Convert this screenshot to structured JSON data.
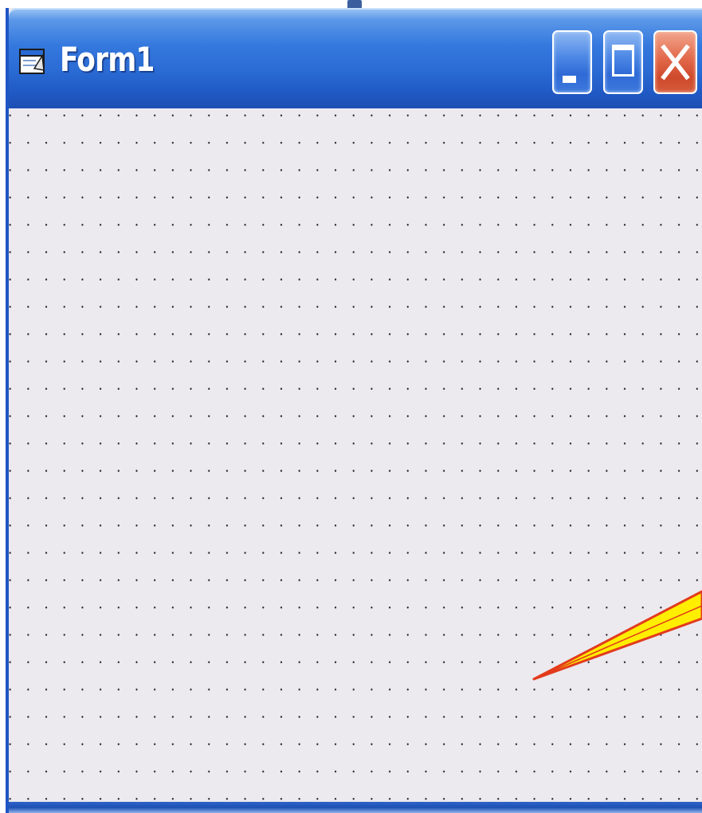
{
  "window": {
    "title": "Form1",
    "icon": "form-window-icon",
    "controls": {
      "minimize": "minimize-icon",
      "maximize": "maximize-icon",
      "close": "close-icon"
    }
  },
  "form": {
    "background": "#ece9ef",
    "grid": "dot-grid"
  },
  "annotation": {
    "type": "arrow",
    "fill": "#ffee00",
    "stroke": "#e23b1c"
  },
  "colors": {
    "titlebar_blue": "#2a6bd4",
    "close_red": "#d45a3b",
    "border_blue": "#1f55c4"
  }
}
